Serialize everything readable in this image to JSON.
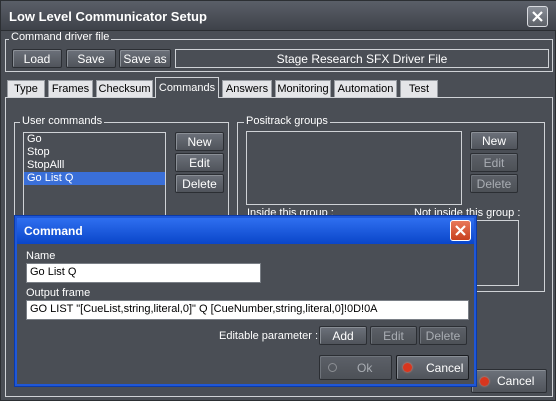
{
  "window": {
    "title": "Low Level Communicator Setup"
  },
  "driver_file": {
    "group_label": "Command driver file",
    "load_label": "Load",
    "save_label": "Save",
    "save_as_label": "Save as",
    "file_name": "Stage Research SFX Driver File"
  },
  "tabs": [
    {
      "label": "Type"
    },
    {
      "label": "Frames"
    },
    {
      "label": "Checksum"
    },
    {
      "label": "Commands"
    },
    {
      "label": "Answers"
    },
    {
      "label": "Monitoring"
    },
    {
      "label": "Automation"
    },
    {
      "label": "Test"
    }
  ],
  "user_commands": {
    "group_label": "User commands",
    "items": [
      "Go",
      "Stop",
      "StopAlll",
      "Go List Q"
    ],
    "selected": "Go List Q",
    "new_label": "New",
    "edit_label": "Edit",
    "delete_label": "Delete"
  },
  "positrack": {
    "group_label": "Positrack groups",
    "new_label": "New",
    "edit_label": "Edit",
    "delete_label": "Delete",
    "inside_label": "Inside this group :",
    "not_inside_label": "Not inside this group :"
  },
  "main_cancel_label": "Cancel",
  "command_dialog": {
    "title": "Command",
    "name_label": "Name",
    "name_value": "Go List Q",
    "output_label": "Output frame",
    "output_value": "GO LIST \"[CueList,string,literal,0]\" Q [CueNumber,string,literal,0]!0D!0A",
    "editable_param_label": "Editable parameter :",
    "add_label": "Add",
    "edit_label": "Edit",
    "delete_label": "Delete",
    "ok_label": "Ok",
    "cancel_label": "Cancel"
  },
  "colors": {
    "window_bg": "#4a4e55",
    "dialog_title_blue": "#1f57d6",
    "selection_blue": "#3a6fd8",
    "cancel_red": "#d8361e",
    "ok_indicator": "#8c8f94"
  }
}
